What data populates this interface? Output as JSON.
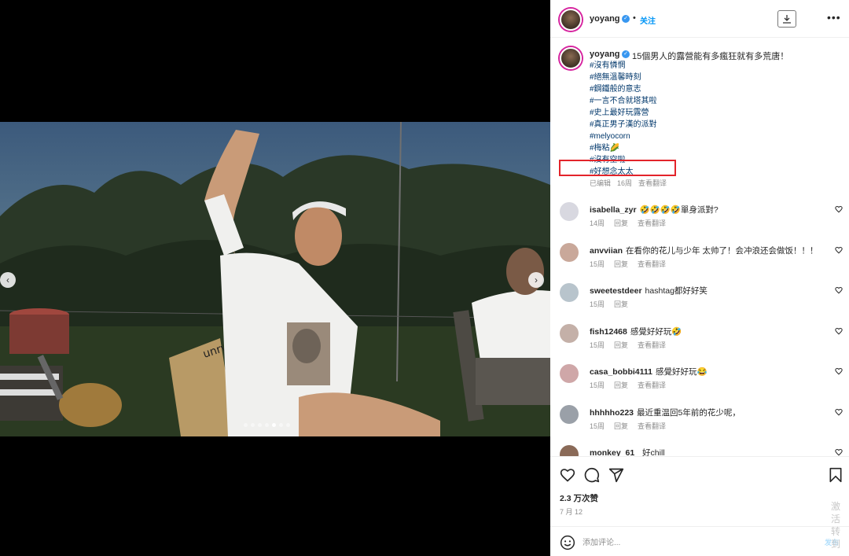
{
  "post": {
    "author": "yoyang",
    "follow_label": "关注",
    "more_label": "•••",
    "dot": "•"
  },
  "caption": {
    "username": "yoyang",
    "text": "15個男人的露營能有多瘋狂就有多荒唐！",
    "hashtags": [
      "#沒有憐惘",
      "#絕無溫馨時刻",
      "#鋼鐵般的意志",
      "#一言不合就塔其啦",
      "#史上最好玩露營",
      "#真正男子漢的派對",
      "#melyocorn",
      "#梅粘🌽",
      "#沒有空啦",
      "#好想念太太"
    ],
    "edited": "已编辑",
    "age": "16周",
    "see_translation": "查看翻译"
  },
  "comments": [
    {
      "user": "isabella_zyr",
      "text": "🤣🤣🤣🤣單身派對?",
      "age": "14周",
      "reply": "回复",
      "translate": "查看翻译"
    },
    {
      "user": "anvviian",
      "text": "在看你的花儿与少年 太帅了！会冲浪还会做饭！！！",
      "age": "15周",
      "reply": "回复",
      "translate": "查看翻译"
    },
    {
      "user": "sweetestdeer",
      "text": "hashtag都好好笑",
      "age": "15周",
      "reply": "回复",
      "translate": ""
    },
    {
      "user": "fish12468",
      "text": "感覺好好玩🤣",
      "age": "15周",
      "reply": "回复",
      "translate": "查看翻译"
    },
    {
      "user": "casa_bobbi4111",
      "text": "感覺好好玩😂",
      "age": "15周",
      "reply": "回复",
      "translate": "查看翻译"
    },
    {
      "user": "hhhhho223",
      "text": "最近重温回5年前的花少呢，",
      "age": "15周",
      "reply": "回复",
      "translate": "查看翻译"
    },
    {
      "user": "monkey_61_",
      "text": "好chill",
      "age": "",
      "reply": "",
      "translate": ""
    }
  ],
  "actions": {
    "likes": "2.3 万次赞",
    "date": "7 月 12",
    "comment_placeholder": "添加评论...",
    "post_label": "发布"
  },
  "watermark": [
    "激活",
    "转到"
  ],
  "carousel": {
    "count": 7,
    "active_index": 4
  },
  "colors": {
    "verified": "#3897f0",
    "follow": "#0095f6",
    "hashtag": "#00376b",
    "highlight_box": "#e3242b"
  },
  "icons": [
    "chevron-left-icon",
    "chevron-right-icon",
    "download-icon",
    "more-icon",
    "heart-icon",
    "comment-icon",
    "share-icon",
    "bookmark-icon",
    "emoji-icon"
  ]
}
